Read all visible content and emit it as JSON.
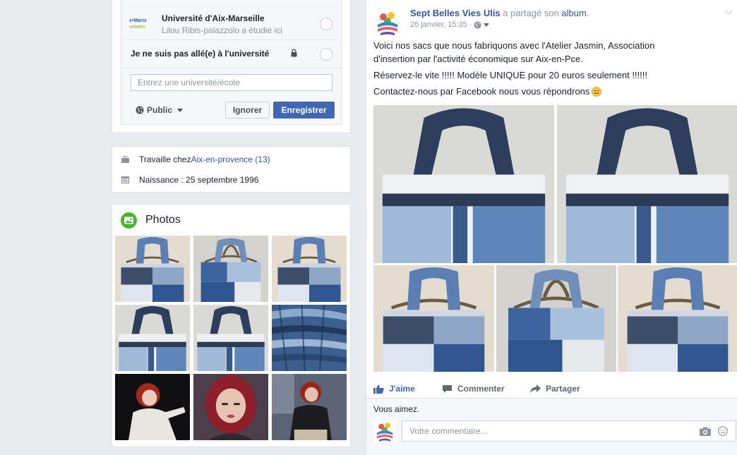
{
  "education": {
    "university_logo_line1": "x•Marsı",
    "university_logo_line2": "univers",
    "university_name": "Université d'Aix-Marseille",
    "university_subtext": "Lilou Ribis-palazzolo a étudié ici",
    "none_option": "Je ne suis pas allé(e) à l'université",
    "school_placeholder": "Entrez une université/école",
    "audience_label": "Public",
    "ignore_label": "Ignorer",
    "save_label": "Enregistrer"
  },
  "intro": {
    "work_prefix": "Travaille chez ",
    "work_link": "Aix-en-provence (13)",
    "birth": "Naissance : 25 septembre 1996"
  },
  "photos": {
    "title": "Photos"
  },
  "post": {
    "page_name": "Sept Belles Vies Ulis",
    "shared_text": " a partagé son ",
    "album_link": "album",
    "shared_end": ".",
    "timestamp": "26 janvier, 15:35 ·",
    "line1": "Voici nos sacs que nous fabriquons avec l'Atelier Jasmin, Association",
    "line2": "d'insertion par l'activité économique sur Aix-en-Pce.",
    "line3": "Réservez-le vite !!!!! Modèle UNIQUE pour 20 euros seulement !!!!!!",
    "line4": "Contactez-nous par Facebook nous vous répondrons",
    "like_label": "J'aime",
    "comment_label": "Commenter",
    "share_label": "Partager",
    "likes_summary": "Vous aimez.",
    "comment_placeholder": "Votre commentaire..."
  },
  "icons": {
    "lock": "lock-icon",
    "globe": "globe-icon",
    "briefcase": "briefcase-icon",
    "calendar": "calendar-icon",
    "photos": "photos-icon",
    "like": "thumbs-up-icon",
    "comment": "comment-icon",
    "share": "share-arrow-icon",
    "camera": "camera-icon",
    "emoji": "emoji-icon"
  },
  "colors": {
    "link": "#365899",
    "primary_button": "#4267b2",
    "photos_icon": "#42b72a",
    "background": "#e9ebee"
  }
}
